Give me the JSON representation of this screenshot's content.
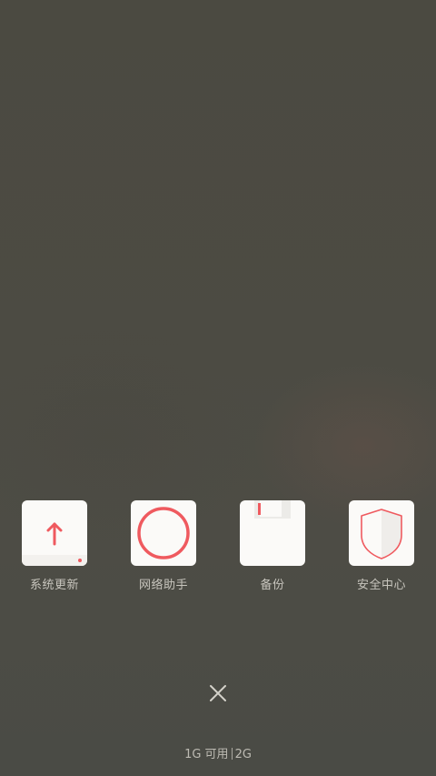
{
  "colors": {
    "background": "#4b4a42",
    "tile_background": "#fbfaf8",
    "accent_red": "#ef5a5f",
    "label_text": "#c7c5bd"
  },
  "apps": [
    {
      "label": "系统更新",
      "icon": "arrow-up-icon"
    },
    {
      "label": "网络助手",
      "icon": "circle-ring-icon"
    },
    {
      "label": "备份",
      "icon": "floppy-disk-icon"
    },
    {
      "label": "安全中心",
      "icon": "shield-icon"
    }
  ],
  "close_button": {
    "icon": "close-icon"
  },
  "memory": {
    "available": "1G 可用",
    "total": "2G"
  }
}
